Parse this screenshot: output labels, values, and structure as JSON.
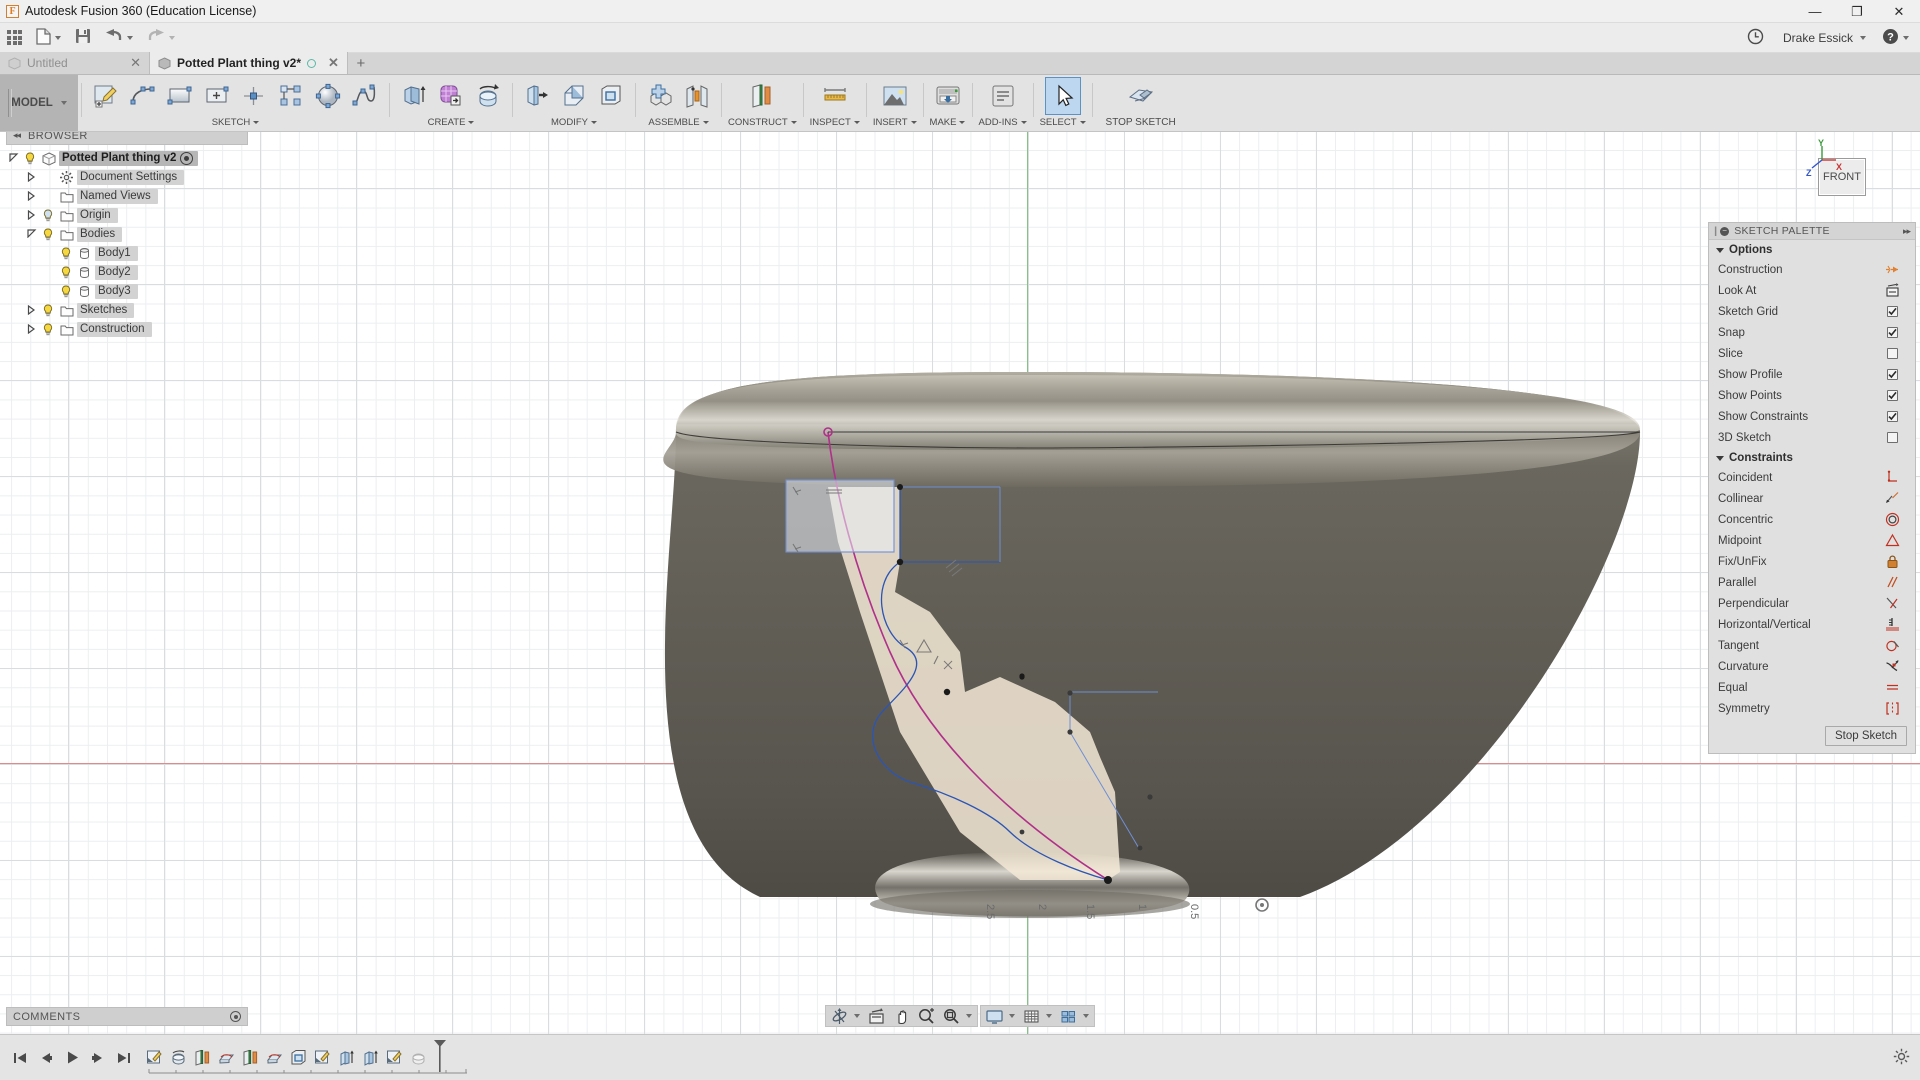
{
  "titlebar": {
    "app_logo": "F",
    "title": "Autodesk Fusion 360 (Education License)",
    "minimize": "—",
    "maximize": "❐",
    "close": "✕"
  },
  "quick_access": {
    "app_grid": "grid-apps-icon",
    "new_file": "new-file-icon",
    "save": "save-icon",
    "undo": "undo-icon",
    "redo": "redo-icon",
    "history_icon": "clock-icon",
    "user_name": "Drake Essick",
    "help_icon": "help-icon"
  },
  "tabs": [
    {
      "label": "Untitled",
      "active": false,
      "modified": false
    },
    {
      "label": "Potted Plant thing v2*",
      "active": true,
      "modified": true
    }
  ],
  "new_tab_label": "+",
  "workspace": {
    "label": "MODEL"
  },
  "ribbon": {
    "groups": [
      {
        "label": "SKETCH",
        "dropdown": true,
        "buttons": [
          {
            "name": "create-sketch-button",
            "icon": "create-sketch-icon"
          },
          {
            "name": "line-button",
            "icon": "line-icon"
          },
          {
            "name": "rectangle-button",
            "icon": "rectangle-icon"
          },
          {
            "name": "center-rectangle-button",
            "icon": "center-rectangle-icon"
          },
          {
            "name": "point-button",
            "icon": "point-icon"
          },
          {
            "name": "rectangular-pattern-button",
            "icon": "rectangular-pattern-icon"
          },
          {
            "name": "circle-button",
            "icon": "circle-icon"
          },
          {
            "name": "spline-button",
            "icon": "spline-icon"
          }
        ]
      },
      {
        "label": "CREATE",
        "dropdown": true,
        "buttons": [
          {
            "name": "extrude-button",
            "icon": "extrude-icon"
          },
          {
            "name": "form-button",
            "icon": "form-icon"
          },
          {
            "name": "revolve-button",
            "icon": "revolve-icon"
          }
        ]
      },
      {
        "label": "MODIFY",
        "dropdown": true,
        "buttons": [
          {
            "name": "press-pull-button",
            "icon": "press-pull-icon"
          },
          {
            "name": "fillet-button",
            "icon": "fillet-icon"
          },
          {
            "name": "shell-button",
            "icon": "shell-icon"
          }
        ]
      },
      {
        "label": "ASSEMBLE",
        "dropdown": true,
        "buttons": [
          {
            "name": "new-component-button",
            "icon": "new-component-icon"
          },
          {
            "name": "joint-button",
            "icon": "joint-icon"
          }
        ]
      },
      {
        "label": "CONSTRUCT",
        "dropdown": true,
        "buttons": [
          {
            "name": "offset-plane-button",
            "icon": "offset-plane-icon"
          }
        ]
      },
      {
        "label": "INSPECT",
        "dropdown": true,
        "buttons": [
          {
            "name": "measure-button",
            "icon": "measure-icon"
          }
        ]
      },
      {
        "label": "INSERT",
        "dropdown": true,
        "buttons": [
          {
            "name": "insert-canvas-button",
            "icon": "insert-canvas-icon"
          }
        ]
      },
      {
        "label": "MAKE",
        "dropdown": true,
        "buttons": [
          {
            "name": "3d-print-button",
            "icon": "3d-print-icon"
          }
        ]
      },
      {
        "label": "ADD-INS",
        "dropdown": true,
        "buttons": [
          {
            "name": "scripts-addins-button",
            "icon": "scripts-addins-icon"
          }
        ]
      },
      {
        "label": "SELECT",
        "dropdown": true,
        "selected": true,
        "buttons": [
          {
            "name": "select-button",
            "icon": "select-arrow-icon"
          }
        ]
      }
    ],
    "stop_sketch": {
      "label": "STOP SKETCH",
      "icon": "stop-sketch-icon"
    }
  },
  "browser": {
    "header": "BROWSER",
    "collapse_icon": "collapse-left-icon",
    "tree": [
      {
        "label": "Potted Plant thing v2",
        "depth": 0,
        "twist": "open",
        "bulb": true,
        "icon": "component-icon",
        "root": true,
        "eye": true
      },
      {
        "label": "Document Settings",
        "depth": 1,
        "twist": "closed",
        "bulb": false,
        "icon": "gear-icon"
      },
      {
        "label": "Named Views",
        "depth": 1,
        "twist": "closed",
        "bulb": false,
        "icon": "folder-icon"
      },
      {
        "label": "Origin",
        "depth": 1,
        "twist": "closed",
        "bulb": "dim",
        "icon": "folder-icon"
      },
      {
        "label": "Bodies",
        "depth": 1,
        "twist": "open",
        "bulb": true,
        "icon": "folder-icon"
      },
      {
        "label": "Body1",
        "depth": 2,
        "twist": "none",
        "bulb": true,
        "icon": "body-icon"
      },
      {
        "label": "Body2",
        "depth": 2,
        "twist": "none",
        "bulb": true,
        "icon": "body-icon"
      },
      {
        "label": "Body3",
        "depth": 2,
        "twist": "none",
        "bulb": true,
        "icon": "body-icon"
      },
      {
        "label": "Sketches",
        "depth": 1,
        "twist": "closed",
        "bulb": true,
        "icon": "folder-icon"
      },
      {
        "label": "Construction",
        "depth": 1,
        "twist": "closed",
        "bulb": true,
        "icon": "folder-icon"
      }
    ]
  },
  "comments": {
    "label": "COMMENTS",
    "icon": "comment-toggle-icon"
  },
  "viewcube": {
    "face_label": "FRONT",
    "axis_y": "Y",
    "axis_x": "X",
    "axis_z": "Z",
    "color_y": "#3a9a3a",
    "color_x": "#cc3333",
    "color_z": "#3355cc"
  },
  "sketch_palette": {
    "header": "SKETCH PALETTE",
    "sections": [
      {
        "title": "Options",
        "rows": [
          {
            "label": "Construction",
            "control": "icon",
            "icon": "construction-icon"
          },
          {
            "label": "Look At",
            "control": "icon",
            "icon": "look-at-icon"
          },
          {
            "label": "Sketch Grid",
            "control": "checkbox",
            "checked": true
          },
          {
            "label": "Snap",
            "control": "checkbox",
            "checked": true
          },
          {
            "label": "Slice",
            "control": "checkbox",
            "checked": false
          },
          {
            "label": "Show Profile",
            "control": "checkbox",
            "checked": true
          },
          {
            "label": "Show Points",
            "control": "checkbox",
            "checked": true
          },
          {
            "label": "Show Constraints",
            "control": "checkbox",
            "checked": true
          },
          {
            "label": "3D Sketch",
            "control": "checkbox",
            "checked": false
          }
        ]
      },
      {
        "title": "Constraints",
        "rows": [
          {
            "label": "Coincident",
            "control": "icon",
            "icon": "coincident-icon"
          },
          {
            "label": "Collinear",
            "control": "icon",
            "icon": "collinear-icon"
          },
          {
            "label": "Concentric",
            "control": "icon",
            "icon": "concentric-icon"
          },
          {
            "label": "Midpoint",
            "control": "icon",
            "icon": "midpoint-icon"
          },
          {
            "label": "Fix/UnFix",
            "control": "icon",
            "icon": "fix-unfix-lock-icon"
          },
          {
            "label": "Parallel",
            "control": "icon",
            "icon": "parallel-icon"
          },
          {
            "label": "Perpendicular",
            "control": "icon",
            "icon": "perpendicular-icon"
          },
          {
            "label": "Horizontal/Vertical",
            "control": "icon",
            "icon": "horizontal-vertical-icon"
          },
          {
            "label": "Tangent",
            "control": "icon",
            "icon": "tangent-icon"
          },
          {
            "label": "Curvature",
            "control": "icon",
            "icon": "curvature-icon"
          },
          {
            "label": "Equal",
            "control": "icon",
            "icon": "equal-icon"
          },
          {
            "label": "Symmetry",
            "control": "icon",
            "icon": "symmetry-icon"
          }
        ]
      }
    ],
    "stop_sketch_label": "Stop Sketch"
  },
  "canvas": {
    "ruler_labels": [
      "2.5",
      "2",
      "1.5",
      "1",
      "0.5"
    ],
    "grid_accent": "#d9dde0",
    "x_axis_color": "#e08b8b",
    "y_axis_color": "#86c286",
    "profile_fill": "#f2e3cf",
    "sketch_curve_color": "#3355cc",
    "selected_curve_color": "#b0308a"
  },
  "nav_bar": {
    "groups": [
      [
        {
          "name": "orbit-button",
          "icon": "orbit-icon",
          "dropdown": true
        },
        {
          "name": "look-at-button",
          "icon": "look-at-icon",
          "dropdown": false
        },
        {
          "name": "pan-button",
          "icon": "pan-hand-icon",
          "dropdown": false
        },
        {
          "name": "zoom-button",
          "icon": "zoom-icon",
          "dropdown": false
        },
        {
          "name": "fit-button",
          "icon": "fit-icon",
          "dropdown": true
        }
      ],
      [
        {
          "name": "display-settings-button",
          "icon": "display-settings-icon",
          "dropdown": true
        },
        {
          "name": "grid-snaps-button",
          "icon": "grid-snaps-icon",
          "dropdown": true
        },
        {
          "name": "viewports-button",
          "icon": "viewports-icon",
          "dropdown": true
        }
      ]
    ]
  },
  "timeline": {
    "playback": [
      {
        "name": "jump-to-beginning-button",
        "icon": "skip-start-icon"
      },
      {
        "name": "step-back-button",
        "icon": "step-back-icon"
      },
      {
        "name": "play-button",
        "icon": "play-icon"
      },
      {
        "name": "step-forward-button",
        "icon": "step-forward-icon"
      },
      {
        "name": "jump-to-end-button",
        "icon": "skip-end-icon"
      }
    ],
    "features": [
      {
        "name": "timeline-sketch-1",
        "icon": "sketch-feature-icon"
      },
      {
        "name": "timeline-revolve-1",
        "icon": "revolve-feature-icon"
      },
      {
        "name": "timeline-plane-1",
        "icon": "plane-feature-icon"
      },
      {
        "name": "timeline-loft-1",
        "icon": "loft-feature-icon"
      },
      {
        "name": "timeline-plane-2",
        "icon": "plane-feature-icon"
      },
      {
        "name": "timeline-loft-2",
        "icon": "loft-feature-icon"
      },
      {
        "name": "timeline-shell-1",
        "icon": "shell-feature-icon"
      },
      {
        "name": "timeline-sketch-2",
        "icon": "sketch-feature-icon"
      },
      {
        "name": "timeline-extrude-1",
        "icon": "extrude-feature-icon"
      },
      {
        "name": "timeline-extrude-2",
        "icon": "extrude-feature-icon"
      },
      {
        "name": "timeline-sketch-3",
        "icon": "sketch-feature-icon"
      },
      {
        "name": "timeline-revolve-2",
        "icon": "revolve-feature-pending-icon"
      }
    ],
    "settings_icon": "settings-gear-icon"
  }
}
